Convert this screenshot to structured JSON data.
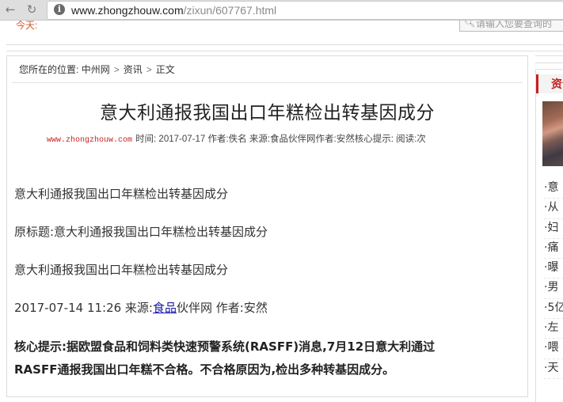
{
  "browser": {
    "back_icon": "back-arrow-icon",
    "reload_icon": "reload-icon",
    "url_host": "www.zhongzhouw.com",
    "url_path": "/zixun/607767.html"
  },
  "site_header": {
    "strip_text": "今天:",
    "search_placeholder": "请输入您要查询的"
  },
  "breadcrumb": {
    "prefix": "您所在的位置:",
    "items": [
      "中州网",
      "资讯",
      "正文"
    ]
  },
  "article": {
    "title": "意大利通报我国出口年糕检出转基因成分",
    "meta_site": "www.zhongzhouw.com",
    "meta_text": "时间:  2017-07-17 作者:佚名 来源:食品伙伴网作者:安然核心提示:  阅读:次",
    "p1": "意大利通报我国出口年糕检出转基因成分",
    "p2": "原标题:意大利通报我国出口年糕检出转基因成分",
    "p3": "意大利通报我国出口年糕检出转基因成分",
    "p4_before": "2017-07-14 11:26 来源:",
    "p4_link": "食品",
    "p4_after": "伙伴网 作者:安然",
    "p5_line1": "核心提示:据欧盟食品和饲料类快速预警系统(RASFF)消息,7月12日意大利通过",
    "p5_line2": "RASFF通报我国出口年糕不合格。不合格原因为,检出多种转基因成分。"
  },
  "sidebar": {
    "heading": "资讯",
    "items": [
      "·意",
      "·从",
      "·妇",
      "·痛",
      "·曝",
      "·男",
      "·5亿",
      "·左",
      "·喂",
      "·天"
    ]
  }
}
